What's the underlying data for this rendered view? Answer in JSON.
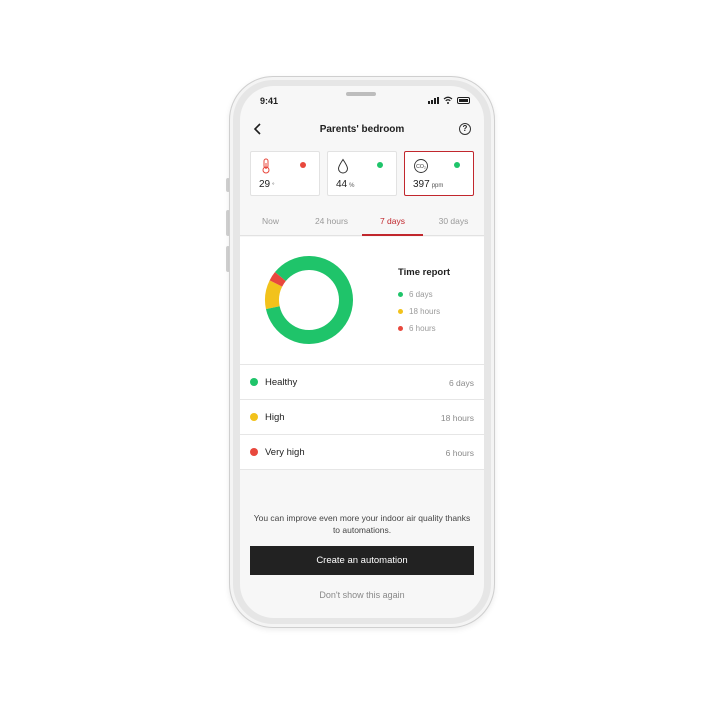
{
  "status_bar": {
    "time": "9:41"
  },
  "header": {
    "title": "Parents' bedroom",
    "help_glyph": "?"
  },
  "metrics": [
    {
      "name": "temperature",
      "icon": "thermometer-icon",
      "value": "29",
      "unit": "°",
      "status_color": "#e8483d",
      "selected": false
    },
    {
      "name": "humidity",
      "icon": "droplet-icon",
      "value": "44",
      "unit": "%",
      "status_color": "#1fc46a",
      "selected": false
    },
    {
      "name": "co2",
      "icon": "co2-icon",
      "icon_text": "CO₂",
      "value": "397",
      "unit": "ppm",
      "status_color": "#1fc46a",
      "selected": true
    }
  ],
  "tabs": [
    {
      "label": "Now",
      "active": false
    },
    {
      "label": "24 hours",
      "active": false
    },
    {
      "label": "7 days",
      "active": true
    },
    {
      "label": "30 days",
      "active": false
    }
  ],
  "time_report": {
    "title": "Time report",
    "legend": [
      {
        "label": "6 days",
        "color": "#1fc46a"
      },
      {
        "label": "18 hours",
        "color": "#f2c21b"
      },
      {
        "label": "6 hours",
        "color": "#e8483d"
      }
    ]
  },
  "chart_data": {
    "type": "pie",
    "style": "donut",
    "categories": [
      "Healthy",
      "High",
      "Very high"
    ],
    "values": [
      144,
      18,
      6
    ],
    "units": "hours",
    "colors": [
      "#1fc46a",
      "#f2c21b",
      "#e8483d"
    ]
  },
  "levels": [
    {
      "label": "Healthy",
      "value": "6 days",
      "color": "#1fc46a"
    },
    {
      "label": "High",
      "value": "18 hours",
      "color": "#f2c21b"
    },
    {
      "label": "Very high",
      "value": "6 hours",
      "color": "#e8483d"
    }
  ],
  "footer": {
    "tip": "You can improve even more your indoor air quality thanks to automations.",
    "cta_label": "Create an automation",
    "dismiss_label": "Don't show this again"
  },
  "colors": {
    "accent": "#c1272d",
    "cta_bg": "#222222"
  }
}
